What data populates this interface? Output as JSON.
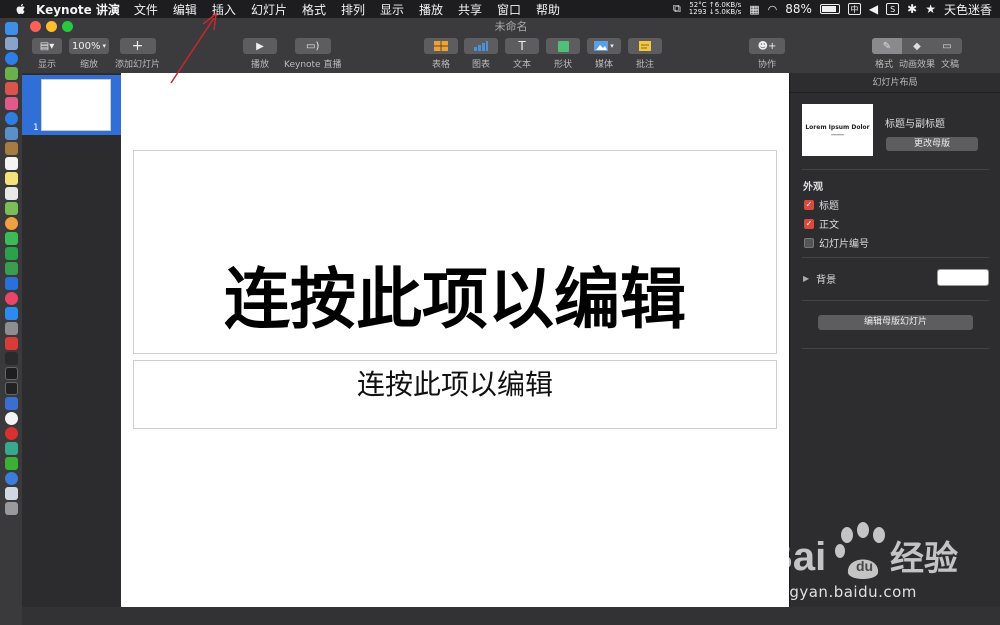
{
  "menubar": {
    "app_name": "Keynote 讲演",
    "items": [
      "文件",
      "编辑",
      "插入",
      "幻灯片",
      "格式",
      "排列",
      "显示",
      "播放",
      "共享",
      "窗口",
      "帮助"
    ],
    "status": {
      "net_line1": "52°C ↑6.0KB/s",
      "net_line2": "1293 ↓5.0KB/s",
      "battery": "88%",
      "input_method": "中",
      "user": "天色迷香"
    }
  },
  "window": {
    "title": "未命名"
  },
  "toolbar": {
    "view_label": "显示",
    "zoom_value": "100%",
    "zoom_label": "缩放",
    "add_slide_label": "添加幻灯片",
    "play_label": "播放",
    "live_label": "Keynote 直播",
    "table_label": "表格",
    "chart_label": "图表",
    "text_label": "文本",
    "shape_label": "形状",
    "media_label": "媒体",
    "comment_label": "批注",
    "collaborate_label": "协作",
    "format_label": "格式",
    "animate_label": "动画效果",
    "document_label": "文稿"
  },
  "navigator": {
    "slide_number": "1"
  },
  "slide": {
    "title": "连按此项以编辑",
    "subtitle": "连按此项以编辑"
  },
  "inspector": {
    "header": "幻灯片布局",
    "thumb_title": "Lorem Ipsum Dolor",
    "layout_name": "标题与副标题",
    "change_master": "更改母版",
    "appearance": "外观",
    "checkbox_title": "标题",
    "checkbox_body": "正文",
    "checkbox_slide_number": "幻灯片编号",
    "checkbox_title_checked": true,
    "checkbox_body_checked": true,
    "checkbox_slide_number_checked": false,
    "background_label": "背景",
    "background_color": "#ffffff",
    "edit_master": "编辑母版幻灯片"
  },
  "watermark": {
    "url": "jingyan.baidu.com"
  },
  "colors": {
    "selection": "#2f6fd6",
    "checkbox_on": "#d94a3d",
    "annotation": "#c8272d"
  }
}
